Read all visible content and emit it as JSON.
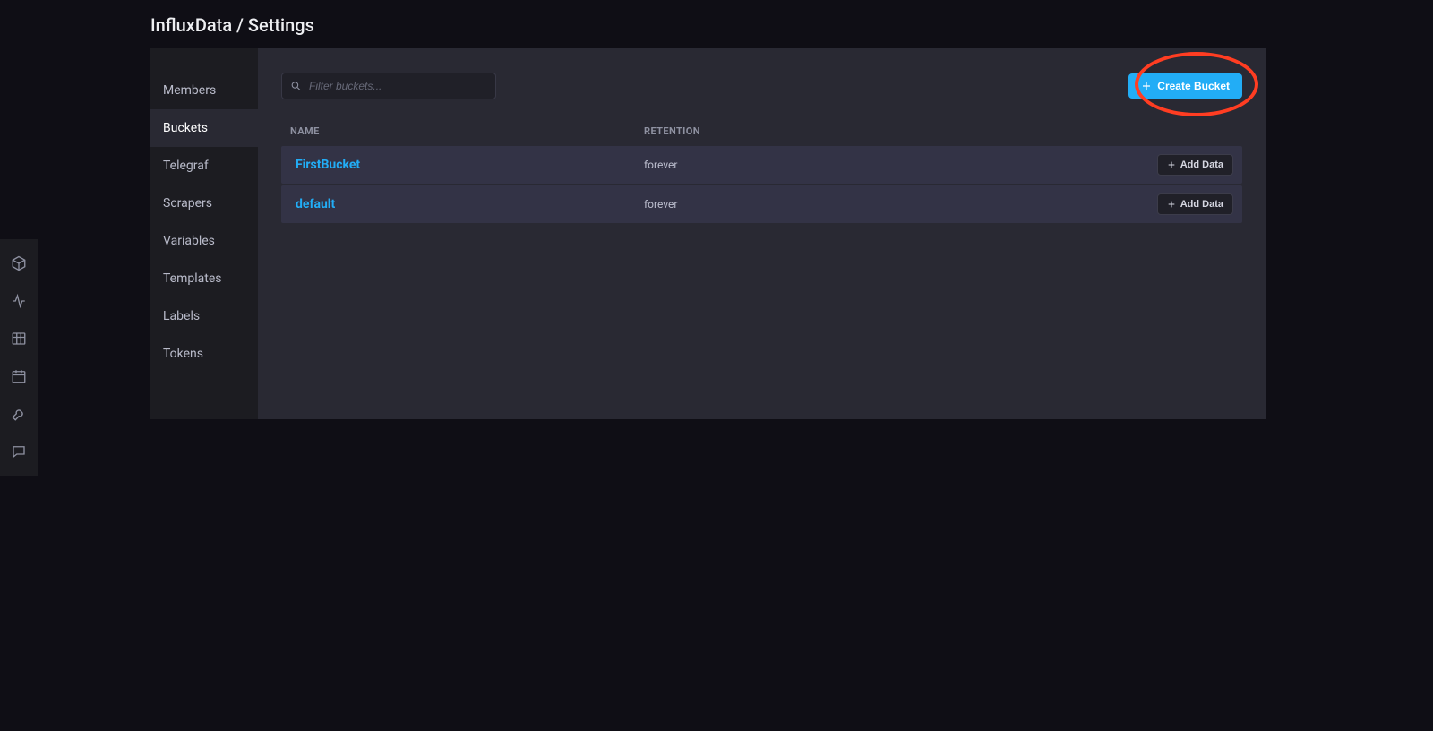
{
  "breadcrumb": {
    "org": "InfluxData",
    "page": "Settings"
  },
  "icon_rail": [
    {
      "name": "cube-icon"
    },
    {
      "name": "activity-icon"
    },
    {
      "name": "grid-icon"
    },
    {
      "name": "calendar-icon"
    },
    {
      "name": "wrench-icon"
    },
    {
      "name": "chat-icon"
    }
  ],
  "side_tabs": [
    {
      "label": "Members",
      "active": false
    },
    {
      "label": "Buckets",
      "active": true
    },
    {
      "label": "Telegraf",
      "active": false
    },
    {
      "label": "Scrapers",
      "active": false
    },
    {
      "label": "Variables",
      "active": false
    },
    {
      "label": "Templates",
      "active": false
    },
    {
      "label": "Labels",
      "active": false
    },
    {
      "label": "Tokens",
      "active": false
    }
  ],
  "toolbar": {
    "search_placeholder": "Filter buckets...",
    "create_label": "Create Bucket"
  },
  "table": {
    "headers": {
      "name": "NAME",
      "retention": "RETENTION"
    },
    "add_data_label": "Add Data",
    "rows": [
      {
        "name": "FirstBucket",
        "retention": "forever"
      },
      {
        "name": "default",
        "retention": "forever"
      }
    ]
  },
  "annotation": {
    "highlight": "create-bucket-button"
  }
}
